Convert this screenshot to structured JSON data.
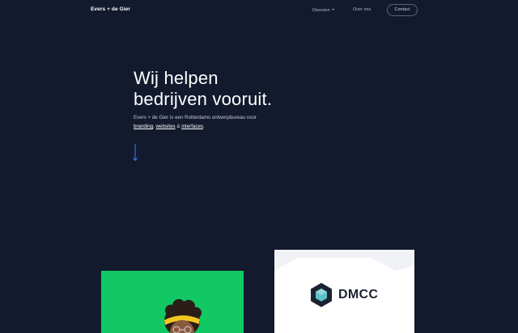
{
  "header": {
    "logo": "Evers + de Gier",
    "nav": {
      "diensten": "Diensten",
      "over_ons": "Over ons",
      "contact": "Contact"
    }
  },
  "hero": {
    "title_line1": "Wij helpen",
    "title_line2": "bedrijven vooruit.",
    "desc_prefix": "Evers + de Gier is een Rotterdams ontwerpbureau voor",
    "link_branding": "branding",
    "link_websites": "websites",
    "link_interfaces": "interfaces",
    "sep_comma": ", ",
    "sep_and": " & ",
    "desc_end": "."
  },
  "cases": {
    "dmcc_logo_text": "DMCC"
  },
  "colors": {
    "background": "#131a2e",
    "accent_arrow": "#3d7bff",
    "green_card": "#11c864",
    "dmcc_card": "#f1f2f6"
  },
  "icons": {
    "nav_caret": "chevron-down-icon",
    "scroll": "arrow-down-icon",
    "dmcc": "hexagon-logo-icon"
  }
}
